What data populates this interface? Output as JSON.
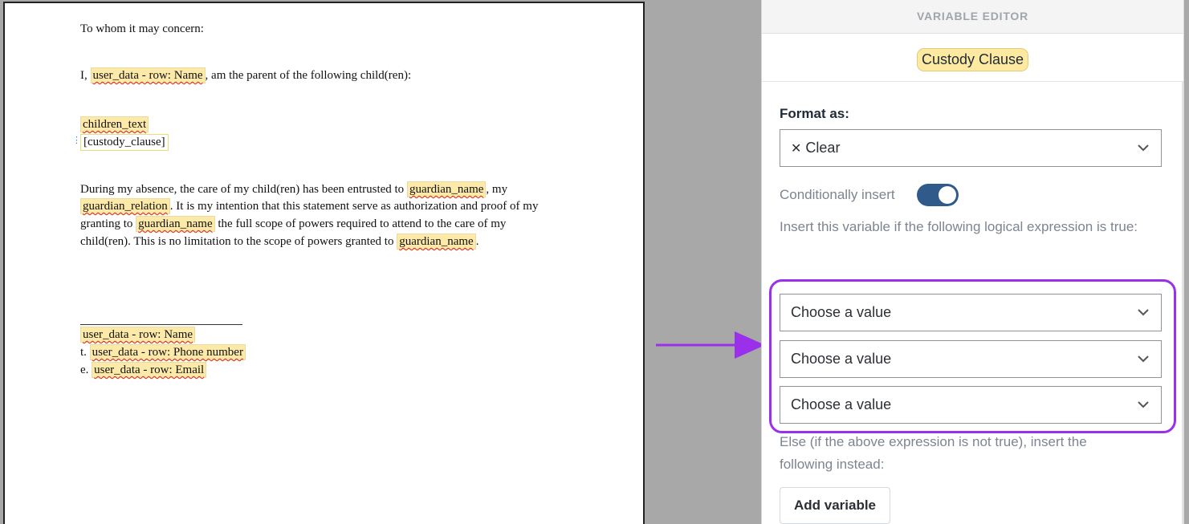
{
  "document": {
    "greeting": "To whom it may concern:",
    "line1_pre": "I,",
    "line1_var": "user_data - row: Name",
    "line1_post": ", am the parent of the following child(ren):",
    "children_var": "children_text",
    "custody_clause": "[custody_clause]",
    "p1_a": "During my absence, the care of my child(ren) has been entrusted to",
    "p1_var1": "guardian_name",
    "p1_b": ", my",
    "p2_var": "guardian_relation",
    "p2_a": ". It is my intention that this statement serve as authorization and proof of my",
    "p3_a": "granting to",
    "p3_var": "guardian_name",
    "p3_b": "the full scope of powers required to attend to the care of my",
    "p4_a": "child(ren). This is no limitation to the scope of powers granted to",
    "p4_var": "guardian_name",
    "p4_b": ".",
    "sig_name": "user_data - row: Name",
    "sig_phone_prefix": "t.",
    "sig_phone": "user_data - row: Phone number",
    "sig_email_prefix": "e.",
    "sig_email": "user_data - row: Email"
  },
  "panel": {
    "header": "VARIABLE EDITOR",
    "variable_name": "Custody Clause",
    "format_label": "Format as:",
    "format_value": "Clear",
    "format_icon": "x-icon",
    "conditional_label": "Conditionally insert",
    "conditional_on": true,
    "condition_help": "Insert this variable if the following logical expression is true:",
    "selects": [
      {
        "value": "Choose a value"
      },
      {
        "value": "Choose a value"
      },
      {
        "value": "Choose a value"
      }
    ],
    "else_help": "Else (if the above expression is not true), insert the following instead:",
    "add_button": "Add variable"
  },
  "colors": {
    "highlight": "#9b30ea",
    "toggle_on": "#2f5a8a",
    "variable_bg": "#fde9a8"
  }
}
